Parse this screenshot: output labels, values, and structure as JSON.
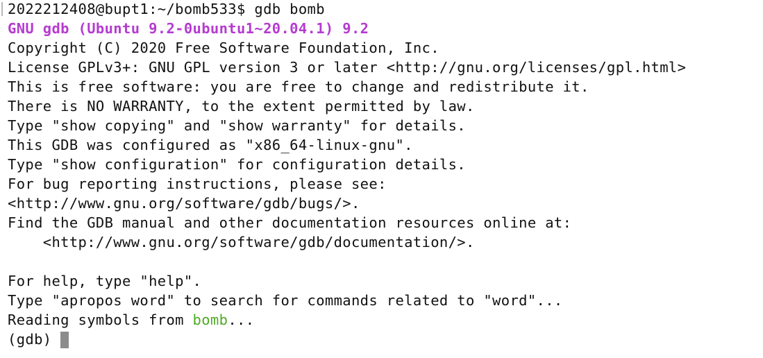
{
  "terminal": {
    "prompt_line": "2022212408@bupt1:~/bomb533$ gdb bomb",
    "banner": "GNU gdb (Ubuntu 9.2-0ubuntu1~20.04.1) 9.2",
    "copyright": "Copyright (C) 2020 Free Software Foundation, Inc.",
    "license": "License GPLv3+: GNU GPL version 3 or later <http://gnu.org/licenses/gpl.html>",
    "free_software": "This is free software: you are free to change and redistribute it.",
    "no_warranty": "There is NO WARRANTY, to the extent permitted by law.",
    "show_copying": "Type \"show copying\" and \"show warranty\" for details.",
    "configured_as": "This GDB was configured as \"x86_64-linux-gnu\".",
    "show_configuration": "Type \"show configuration\" for configuration details.",
    "bug_reporting": "For bug reporting instructions, please see:",
    "bugs_url": "<http://www.gnu.org/software/gdb/bugs/>.",
    "find_manual": "Find the GDB manual and other documentation resources online at:",
    "docs_url": "    <http://www.gnu.org/software/gdb/documentation/>.",
    "help_hint": "For help, type \"help\".",
    "apropos_hint": "Type \"apropos word\" to search for commands related to \"word\"...",
    "reading_prefix": "Reading symbols from ",
    "reading_target": "bomb",
    "reading_suffix": "...",
    "gdb_prompt": "(gdb) "
  },
  "colors": {
    "background": "#ffffff",
    "text": "#111111",
    "banner": "#b53bd0",
    "binary_name": "#4eaa25",
    "cursor": "#8c8c8c"
  }
}
